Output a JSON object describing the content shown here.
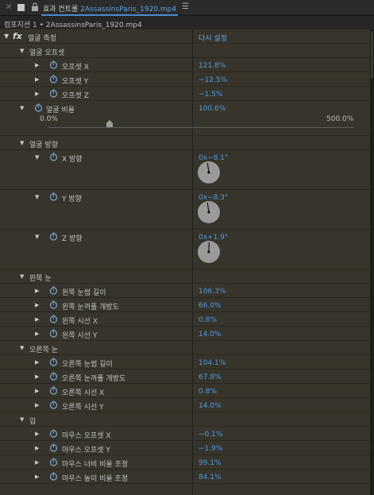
{
  "tab": {
    "close": "×",
    "title_prefix": "효과 컨트롤",
    "title_file": "2AssassinsParis_1920.mp4",
    "menu": "☰"
  },
  "breadcrumb": "컴포지션 1 • 2AssassinsParis_1920.mp4",
  "effect": {
    "name": "얼굴 측정",
    "reset_label": "다시 설정"
  },
  "groups": {
    "face_offset": {
      "label": "얼굴 오프셋",
      "items": [
        {
          "label": "오프셋 X",
          "value": "121.8%"
        },
        {
          "label": "오프셋 Y",
          "value": "−12.5%"
        },
        {
          "label": "오프셋 Z",
          "value": "−1.5%"
        }
      ]
    },
    "face_ratio": {
      "label": "얼굴 비율",
      "value": "100.6%",
      "min": "0.0%",
      "max": "500.0%",
      "slider_fraction": 0.201
    },
    "face_direction": {
      "label": "얼굴 방향",
      "items": [
        {
          "label": "X 방향",
          "value": "0x−8.1°",
          "angle": -8.1
        },
        {
          "label": "Y 방향",
          "value": "0x−8.3°",
          "angle": -8.3
        },
        {
          "label": "Z 방향",
          "value": "0x+1.9°",
          "angle": 1.9
        }
      ]
    },
    "left_eye": {
      "label": "왼쪽 눈",
      "items": [
        {
          "label": "왼쪽 눈썹 길이",
          "value": "106.3%"
        },
        {
          "label": "왼쪽 눈꺼풀 개방도",
          "value": "66.0%"
        },
        {
          "label": "왼쪽 시선 X",
          "value": "0.8%"
        },
        {
          "label": "왼쪽 시선 Y",
          "value": "14.0%"
        }
      ]
    },
    "right_eye": {
      "label": "오른쪽 눈",
      "items": [
        {
          "label": "오른쪽 눈썹 길이",
          "value": "104.1%"
        },
        {
          "label": "오른쪽 눈꺼풀 개방도",
          "value": "67.8%"
        },
        {
          "label": "오른쪽 시선 X",
          "value": "0.8%"
        },
        {
          "label": "오른쪽 시선 Y",
          "value": "14.0%"
        }
      ]
    },
    "mouth": {
      "label": "입",
      "items": [
        {
          "label": "마우스 오프셋 X",
          "value": "−0.1%"
        },
        {
          "label": "마우스 오프셋 Y",
          "value": "−1.9%"
        },
        {
          "label": "마우스 너비 비율 조정",
          "value": "99.1%"
        },
        {
          "label": "마우스 높이 비율 조정",
          "value": "84.1%"
        }
      ]
    }
  },
  "colors": {
    "value_blue": "#4f9be0",
    "panel_bg": "#37342b",
    "stopwatch": "#7aa7d6"
  },
  "icons": {
    "expand": "▶",
    "collapse": "▼"
  }
}
